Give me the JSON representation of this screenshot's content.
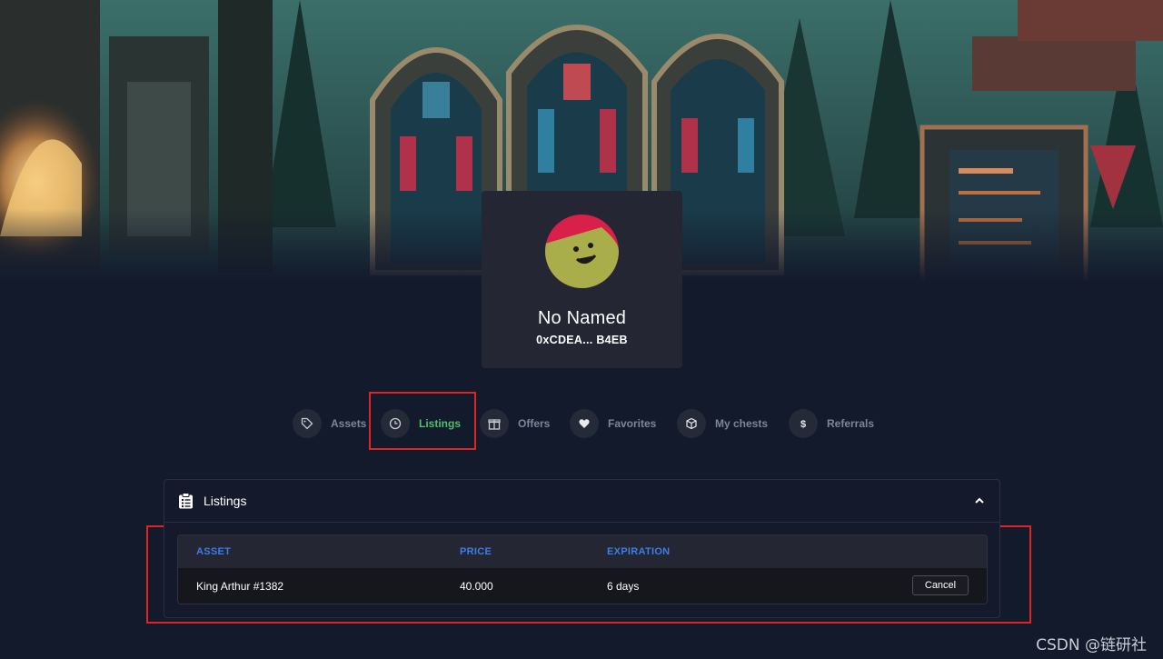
{
  "profile": {
    "name": "No Named",
    "address": "0xCDEA... B4EB"
  },
  "tabs": [
    {
      "label": "Assets",
      "icon": "tag-icon",
      "active": false
    },
    {
      "label": "Listings",
      "icon": "clock-history-icon",
      "active": true
    },
    {
      "label": "Offers",
      "icon": "gift-icon",
      "active": false
    },
    {
      "label": "Favorites",
      "icon": "heart-icon",
      "active": false
    },
    {
      "label": "My chests",
      "icon": "cube-icon",
      "active": false
    },
    {
      "label": "Referrals",
      "icon": "dollar-icon",
      "active": false
    }
  ],
  "panel": {
    "title": "Listings",
    "icon": "clipboard-list-icon",
    "expanded": true
  },
  "table": {
    "columns": [
      "ASSET",
      "PRICE",
      "EXPIRATION"
    ],
    "rows": [
      {
        "asset": "King Arthur #1382",
        "price": "40.000",
        "expiration": "6 days",
        "action": "Cancel"
      }
    ]
  },
  "watermark": "CSDN @链研社",
  "colors": {
    "active_tab": "#4fbf6b",
    "column_header": "#3b7de9",
    "highlight": "#e02424",
    "background": "#131a2c"
  }
}
